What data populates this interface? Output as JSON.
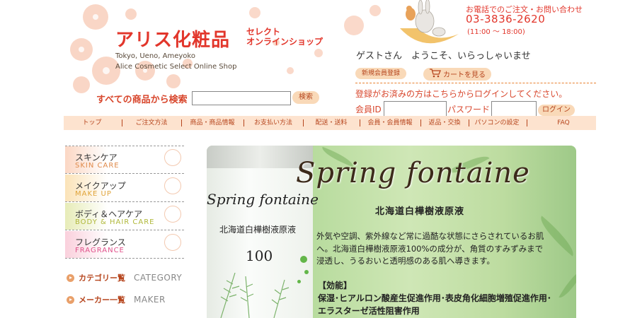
{
  "header": {
    "logo_main": "アリス化粧品",
    "logo_sub_1": "セレクト",
    "logo_sub_2": "オンラインショップ",
    "logo_en_1": "Tokyo, Ueno, Ameyoko",
    "logo_en_2": "Alice Cosmetic Select Online Shop",
    "search_label": "すべての商品から検索",
    "search_placeholder": "",
    "search_button": "検索",
    "tel_label": "お電話でのご注文・お問い合わせ",
    "tel_number": "03-3836-2620",
    "tel_hours": "(11:00 ～ 18:00)",
    "welcome": "ゲストさん　ようこそ、いらっしゃいませ",
    "register_button": "新規会員登録",
    "cart_button": "カートを見る",
    "login_note": "登録がお済みの方はこちらからログインしてください。",
    "member_id_label": "会員ID",
    "password_label": "パスワード",
    "login_button": "ログイン"
  },
  "nav": {
    "items": [
      "トップ",
      "ご注文方法",
      "商品・商品情報",
      "お支払い方法",
      "配送・送料",
      "会員・会員情報",
      "返品・交換",
      "パソコンの設定",
      "FAQ"
    ]
  },
  "sidebar": {
    "items": [
      {
        "jp": "スキンケア",
        "en": "SKIN CARE",
        "color": "#e08a4a"
      },
      {
        "jp": "メイクアップ",
        "en": "MAKE UP",
        "color": "#e0a43a"
      },
      {
        "jp": "ボディ＆ヘアケア",
        "en": "BODY & HAIR CARE",
        "color": "#b0b83a"
      },
      {
        "jp": "フレグランス",
        "en": "FRAGRANCE",
        "color": "#e0508a"
      }
    ],
    "categories": [
      {
        "jp": "カテゴリー覧",
        "en": "CATEGORY"
      },
      {
        "jp": "メーカー一覧",
        "en": "MAKER"
      }
    ]
  },
  "banner": {
    "title": "Spring fontaine",
    "subtitle": "北海道白樺樹液原液",
    "bottle_name": "Spring fontaine",
    "bottle_sub": "北海道白樺樹液原液",
    "bottle_num": "100",
    "description": "外気や空調、紫外線など常に過酷な状態にさらされているお肌へ。北海道白樺樹液原液100%の成分が、角質のすみずみまで浸透し、うるおいと透明感のある肌へ導きます。",
    "effect_heading": "【効能】",
    "effect_text": "保湿･ヒアルロン酸産生促進作用･表皮角化細胞増殖促進作用･エラスターゼ活性阻害作用"
  },
  "colors": {
    "accent": "#e2362b",
    "nav_bg": "#fde3cf",
    "button_bg": "#f9d9b8"
  }
}
